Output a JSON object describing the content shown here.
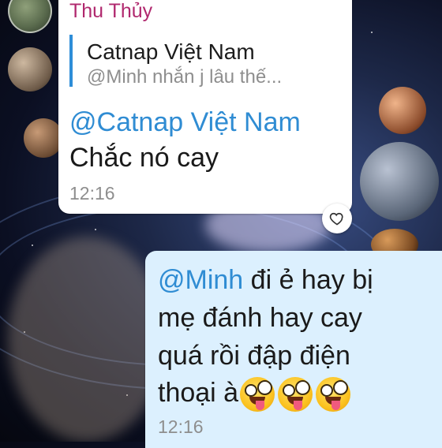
{
  "chat": {
    "incoming": {
      "sender": "Thu Thủy",
      "reply": {
        "name": "Catnap Việt Nam",
        "text": "@Minh nhắn j lâu thế..."
      },
      "mention": "@Catnap Việt Nam",
      "text": "Chắc nó cay",
      "time": "12:16",
      "reaction_icon": "heart-outline-icon"
    },
    "outgoing": {
      "mention": "@Minh",
      "line1_rest": " đi ẻ hay bị",
      "line2": "mẹ đánh hay cay",
      "line3": "quá rồi đập điện",
      "line4": "thoại à",
      "emoji": [
        "zany-face-emoji",
        "zany-face-emoji",
        "zany-face-emoji"
      ],
      "time": "12:16"
    }
  },
  "colors": {
    "sender_name": "#b0286e",
    "mention": "#2f8cd3",
    "reply_bar": "#2e8ed8",
    "outgoing_bubble": "#dcf0fe",
    "incoming_bubble": "#ffffff"
  }
}
